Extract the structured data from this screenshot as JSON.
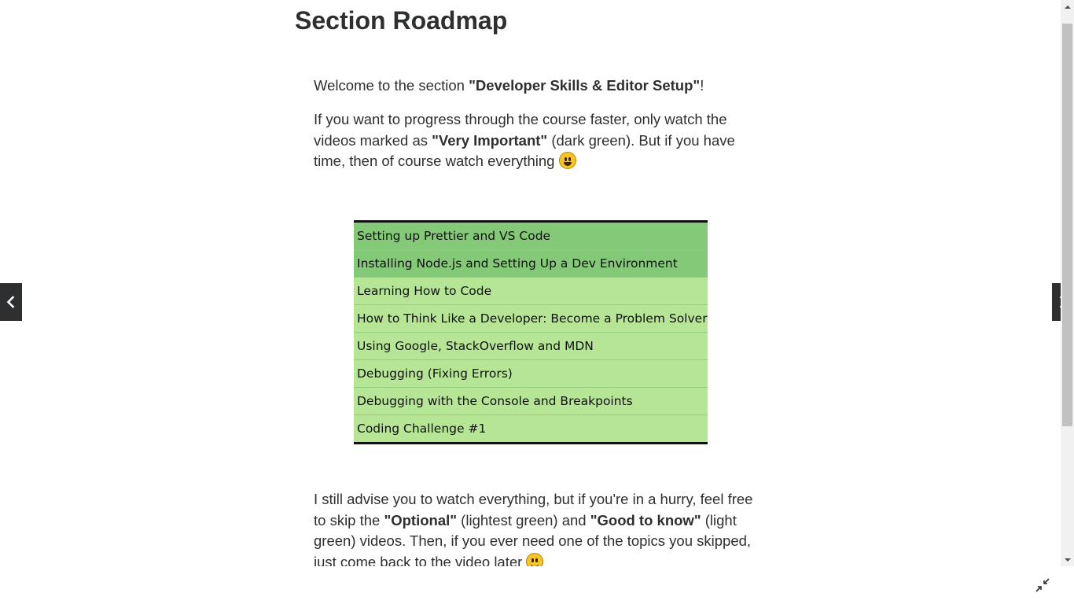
{
  "page": {
    "title": "Section Roadmap"
  },
  "content": {
    "p1": {
      "before": "Welcome to the section ",
      "bold": "\"Developer Skills & Editor Setup\"",
      "after": "!"
    },
    "p2": {
      "before": "If you want to progress through the course faster, only watch the videos marked as ",
      "bold": "\"Very Important\"",
      "after": " (dark green). But if you have time, then of course watch everything ",
      "emoji": "grinning-face-emoji"
    },
    "p3": {
      "before": "I still advise you to watch everything, but if you're in a hurry, feel free to skip the ",
      "bold1": "\"Optional\"",
      "middle": " (lightest green) and ",
      "bold2": "\"Good to know\"",
      "after": " (light green) videos. Then, if you ever need one of the topics you skipped, just come back to the video later ",
      "emoji": "winking-face-emoji"
    }
  },
  "roadmap": {
    "rows": [
      {
        "label": "Setting up Prettier and VS Code",
        "level": "Very Important",
        "color": "#84c978"
      },
      {
        "label": "Installing Node.js and Setting Up a Dev Environment",
        "level": "Very Important",
        "color": "#84c978"
      },
      {
        "label": "Learning How to Code",
        "level": "Good to know",
        "color": "#b6e596"
      },
      {
        "label": "How to Think Like a Developer: Become a Problem Solver!",
        "level": "Good to know",
        "color": "#b6e596"
      },
      {
        "label": "Using Google, StackOverflow and MDN",
        "level": "Good to know",
        "color": "#b6e596"
      },
      {
        "label": "Debugging (Fixing Errors)",
        "level": "Good to know",
        "color": "#b6e596"
      },
      {
        "label": "Debugging with the Console and Breakpoints",
        "level": "Good to know",
        "color": "#b6e596"
      },
      {
        "label": "Coding Challenge #1",
        "level": "Good to know",
        "color": "#b6e596"
      }
    ]
  },
  "nav": {
    "prev_icon": "chevron-left-icon",
    "next_icon": "chevron-right-icon"
  },
  "controls": {
    "exit_fullscreen_icon": "exit-fullscreen-icon"
  },
  "colors": {
    "very_important": "#84c978",
    "good_to_know": "#b6e596",
    "nav_button": "#2d2f31",
    "text": "#2d2f31"
  }
}
